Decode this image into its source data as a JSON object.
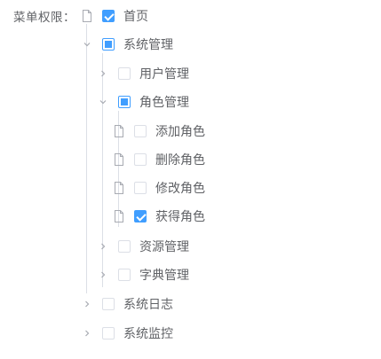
{
  "form": {
    "label": "菜单权限："
  },
  "tree": {
    "home": "首页",
    "system": "系统管理",
    "user_mgmt": "用户管理",
    "role_mgmt": "角色管理",
    "add_role": "添加角色",
    "delete_role": "删除角色",
    "edit_role": "修改角色",
    "get_role": "获得角色",
    "resource_mgmt": "资源管理",
    "dict_mgmt": "字典管理",
    "system_log": "系统日志",
    "system_monitor": "系统监控"
  },
  "colors": {
    "accent": "#409eff",
    "border": "#dcdfe6",
    "text": "#606266",
    "icon": "#a8abb2"
  }
}
